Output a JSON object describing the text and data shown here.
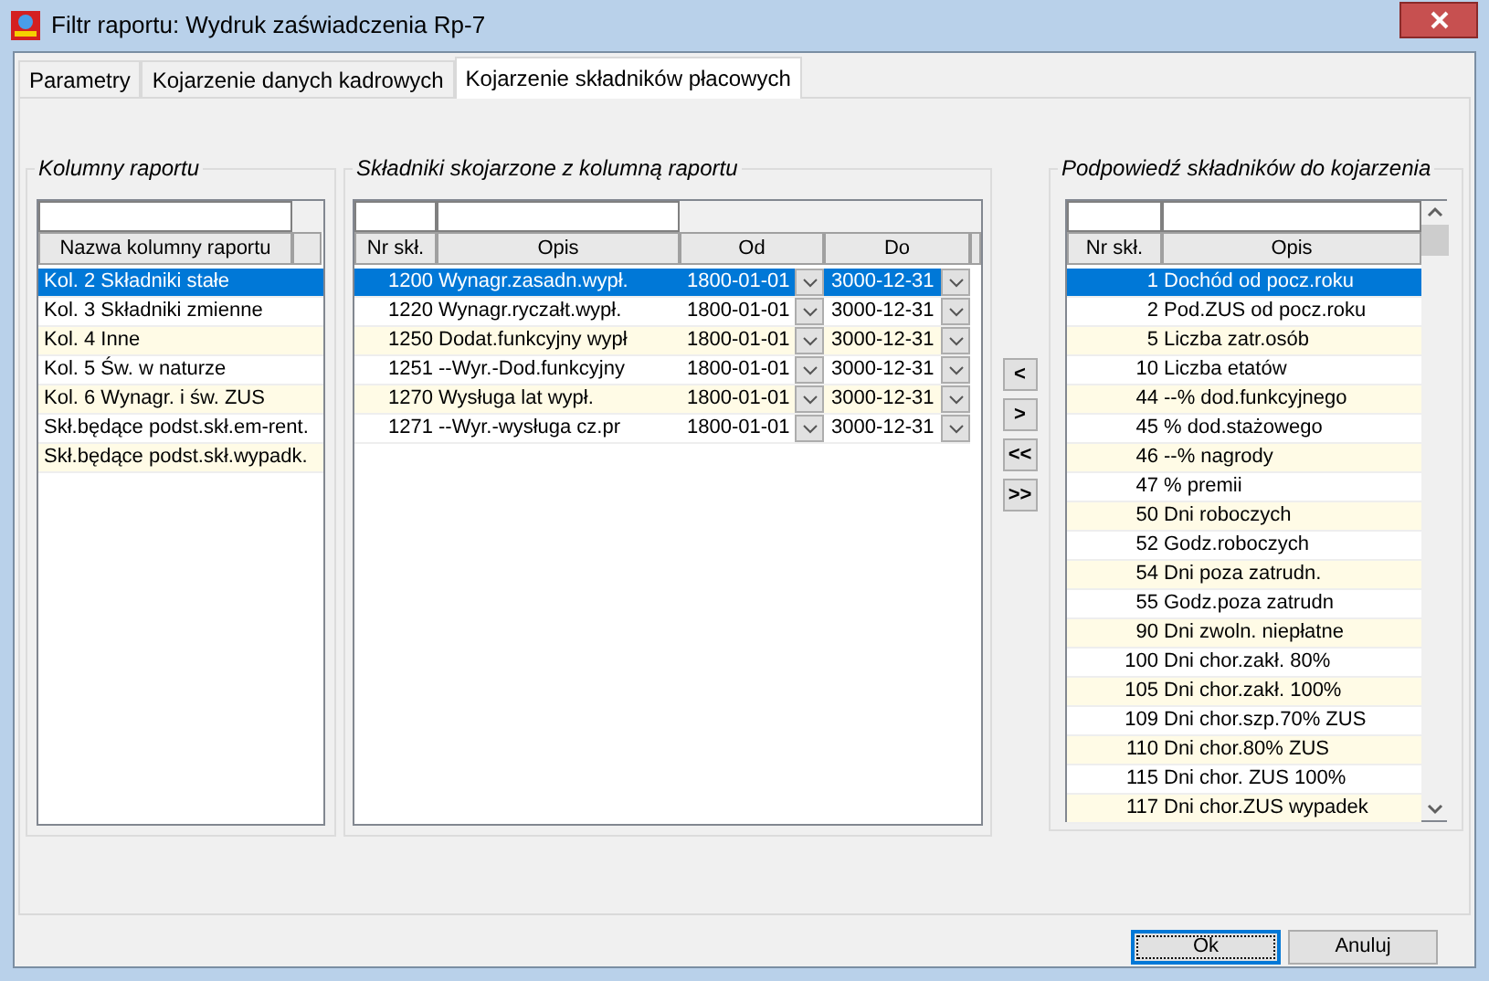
{
  "window": {
    "title": "Filtr raportu: Wydruk zaświadczenia Rp-7"
  },
  "tabs": [
    {
      "label": "Parametry",
      "selected": false
    },
    {
      "label": "Kojarzenie danych kadrowych",
      "selected": false
    },
    {
      "label": "Kojarzenie składników płacowych",
      "selected": true
    }
  ],
  "report_columns": {
    "title": "Kolumny raportu",
    "columns": [
      "Nazwa kolumny raportu"
    ],
    "rows": [
      {
        "name": "Kol. 2 Składniki stałe",
        "selected": true
      },
      {
        "name": "Kol. 3 Składniki zmienne",
        "selected": false
      },
      {
        "name": "Kol. 4 Inne",
        "selected": false
      },
      {
        "name": "Kol. 5 Św. w naturze",
        "selected": false
      },
      {
        "name": "Kol. 6 Wynagr. i św. ZUS",
        "selected": false
      },
      {
        "name": "Skł.będące podst.skł.em-rent.",
        "selected": false
      },
      {
        "name": "Skł.będące podst.skł.wypadk.",
        "selected": false
      }
    ]
  },
  "linked_components": {
    "title": "Składniki skojarzone z kolumną raportu",
    "columns": [
      "Nr skł.",
      "Opis",
      "Od",
      "Do"
    ],
    "rows": [
      {
        "nr": "1200",
        "opis": "Wynagr.zasadn.wypł.",
        "od": "1800-01-01",
        "do": "3000-12-31",
        "selected": true
      },
      {
        "nr": "1220",
        "opis": "Wynagr.ryczałt.wypł.",
        "od": "1800-01-01",
        "do": "3000-12-31",
        "selected": false
      },
      {
        "nr": "1250",
        "opis": "Dodat.funkcyjny wypł",
        "od": "1800-01-01",
        "do": "3000-12-31",
        "selected": false
      },
      {
        "nr": "1251",
        "opis": "--Wyr.-Dod.funkcyjny",
        "od": "1800-01-01",
        "do": "3000-12-31",
        "selected": false
      },
      {
        "nr": "1270",
        "opis": "Wysługa lat wypł.",
        "od": "1800-01-01",
        "do": "3000-12-31",
        "selected": false
      },
      {
        "nr": "1271",
        "opis": "--Wyr.-wysługa cz.pr",
        "od": "1800-01-01",
        "do": "3000-12-31",
        "selected": false
      }
    ]
  },
  "move_buttons": [
    "<",
    ">",
    "<<",
    ">>"
  ],
  "suggested_components": {
    "title": "Podpowiedź składników do kojarzenia",
    "columns": [
      "Nr skł.",
      "Opis"
    ],
    "rows": [
      {
        "nr": "1",
        "opis": "Dochód od pocz.roku",
        "selected": true
      },
      {
        "nr": "2",
        "opis": "Pod.ZUS od pocz.roku",
        "selected": false
      },
      {
        "nr": "5",
        "opis": "Liczba zatr.osób",
        "selected": false
      },
      {
        "nr": "10",
        "opis": "Liczba etatów",
        "selected": false
      },
      {
        "nr": "44",
        "opis": "--% dod.funkcyjnego",
        "selected": false
      },
      {
        "nr": "45",
        "opis": "% dod.stażowego",
        "selected": false
      },
      {
        "nr": "46",
        "opis": "--% nagrody",
        "selected": false
      },
      {
        "nr": "47",
        "opis": "% premii",
        "selected": false
      },
      {
        "nr": "50",
        "opis": "Dni roboczych",
        "selected": false
      },
      {
        "nr": "52",
        "opis": "Godz.roboczych",
        "selected": false
      },
      {
        "nr": "54",
        "opis": "Dni poza zatrudn.",
        "selected": false
      },
      {
        "nr": "55",
        "opis": "Godz.poza zatrudn",
        "selected": false
      },
      {
        "nr": "90",
        "opis": "Dni zwoln. niepłatne",
        "selected": false
      },
      {
        "nr": "100",
        "opis": "Dni chor.zakł. 80%",
        "selected": false
      },
      {
        "nr": "105",
        "opis": "Dni chor.zakł. 100%",
        "selected": false
      },
      {
        "nr": "109",
        "opis": "Dni chor.szp.70% ZUS",
        "selected": false
      },
      {
        "nr": "110",
        "opis": "Dni chor.80% ZUS",
        "selected": false
      },
      {
        "nr": "115",
        "opis": "Dni chor. ZUS 100%",
        "selected": false
      },
      {
        "nr": "117",
        "opis": "Dni chor.ZUS wypadek",
        "selected": false
      }
    ]
  },
  "buttons": [
    {
      "label": "Ok",
      "default": true
    },
    {
      "label": "Anuluj",
      "default": false
    }
  ]
}
